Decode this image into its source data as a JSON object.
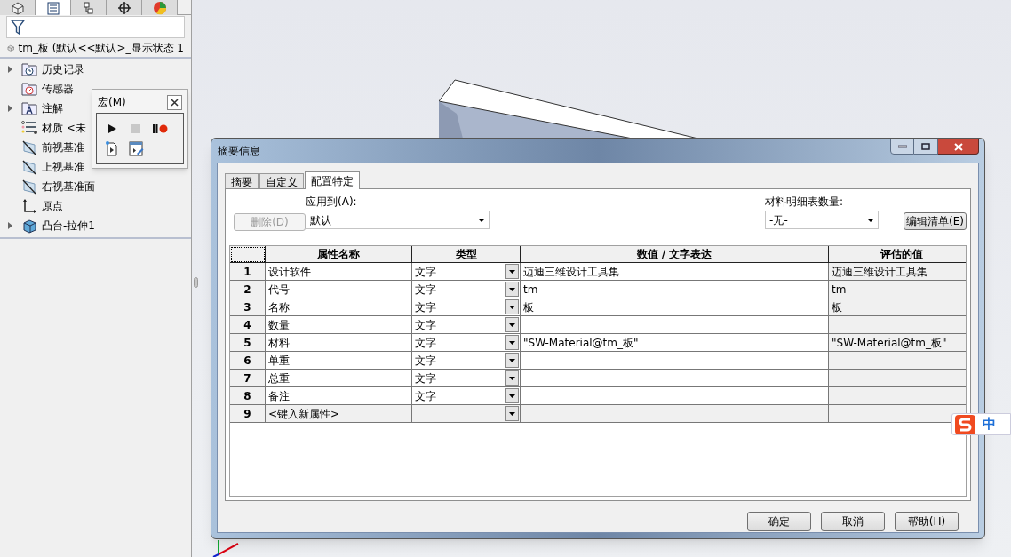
{
  "feature_manager": {
    "tabs": [
      {
        "selected": false
      },
      {
        "selected": true
      },
      {
        "selected": false
      },
      {
        "selected": false
      },
      {
        "selected": false
      }
    ],
    "root": "tm_板  (默认<<默认>_显示状态 1",
    "tree": [
      {
        "label": "历史记录",
        "expanded": false,
        "kind": "history"
      },
      {
        "label": "传感器",
        "kind": "sensor"
      },
      {
        "label": "注解",
        "expanded": false,
        "kind": "annotation"
      },
      {
        "label": "材质 <未",
        "kind": "material"
      },
      {
        "label": "前视基准",
        "kind": "plane"
      },
      {
        "label": "上视基准",
        "kind": "plane"
      },
      {
        "label": "右视基准面",
        "kind": "plane"
      },
      {
        "label": "原点",
        "kind": "origin"
      },
      {
        "label": "凸台-拉伸1",
        "expanded": false,
        "kind": "extrude"
      }
    ]
  },
  "macro_toolbar": {
    "title": "宏(M)",
    "buttons": [
      {
        "kind": "play",
        "disabled": false
      },
      {
        "kind": "stop",
        "disabled": true
      },
      {
        "kind": "pause-record",
        "disabled": false
      },
      {
        "kind": "new",
        "disabled": false
      },
      {
        "kind": "edit",
        "disabled": false
      }
    ]
  },
  "dialog": {
    "title": "摘要信息",
    "tabs": [
      {
        "label": "摘要",
        "selected": false
      },
      {
        "label": "自定义",
        "selected": false
      },
      {
        "label": "配置特定",
        "selected": true
      }
    ],
    "delete_button": {
      "label": "删除(D)",
      "disabled": true
    },
    "apply_to": {
      "label": "应用到(A):",
      "value": "默认"
    },
    "bom_quantity": {
      "label": "材料明细表数量:",
      "value": "-无-"
    },
    "edit_list_button": "编辑清单(E)",
    "table": {
      "columns": [
        "属性名称",
        "类型",
        "数值 / 文字表达",
        "评估的值"
      ],
      "rows": [
        {
          "number": "1",
          "name": "设计软件",
          "type": "文字",
          "value": "迈迪三维设计工具集",
          "evaluated": "迈迪三维设计工具集",
          "kind": "property"
        },
        {
          "number": "2",
          "name": "代号",
          "type": "文字",
          "value": "tm",
          "evaluated": "tm",
          "kind": "property"
        },
        {
          "number": "3",
          "name": "名称",
          "type": "文字",
          "value": "板",
          "evaluated": "板",
          "kind": "property"
        },
        {
          "number": "4",
          "name": "数量",
          "type": "文字",
          "kind": "property"
        },
        {
          "number": "5",
          "name": "材料",
          "type": "文字",
          "value": "\"SW-Material@tm_板\"",
          "evaluated": "\"SW-Material@tm_板\"",
          "kind": "property"
        },
        {
          "number": "6",
          "name": "单重",
          "type": "文字",
          "kind": "property"
        },
        {
          "number": "7",
          "name": "总重",
          "type": "文字",
          "kind": "property"
        },
        {
          "number": "8",
          "name": "备注",
          "type": "文字",
          "kind": "property"
        },
        {
          "number": "9",
          "name": "<键入新属性>",
          "kind": "new"
        }
      ]
    },
    "buttons": [
      "确定",
      "取消",
      "帮助(H)"
    ]
  },
  "ime_bar": {
    "label": "中"
  }
}
